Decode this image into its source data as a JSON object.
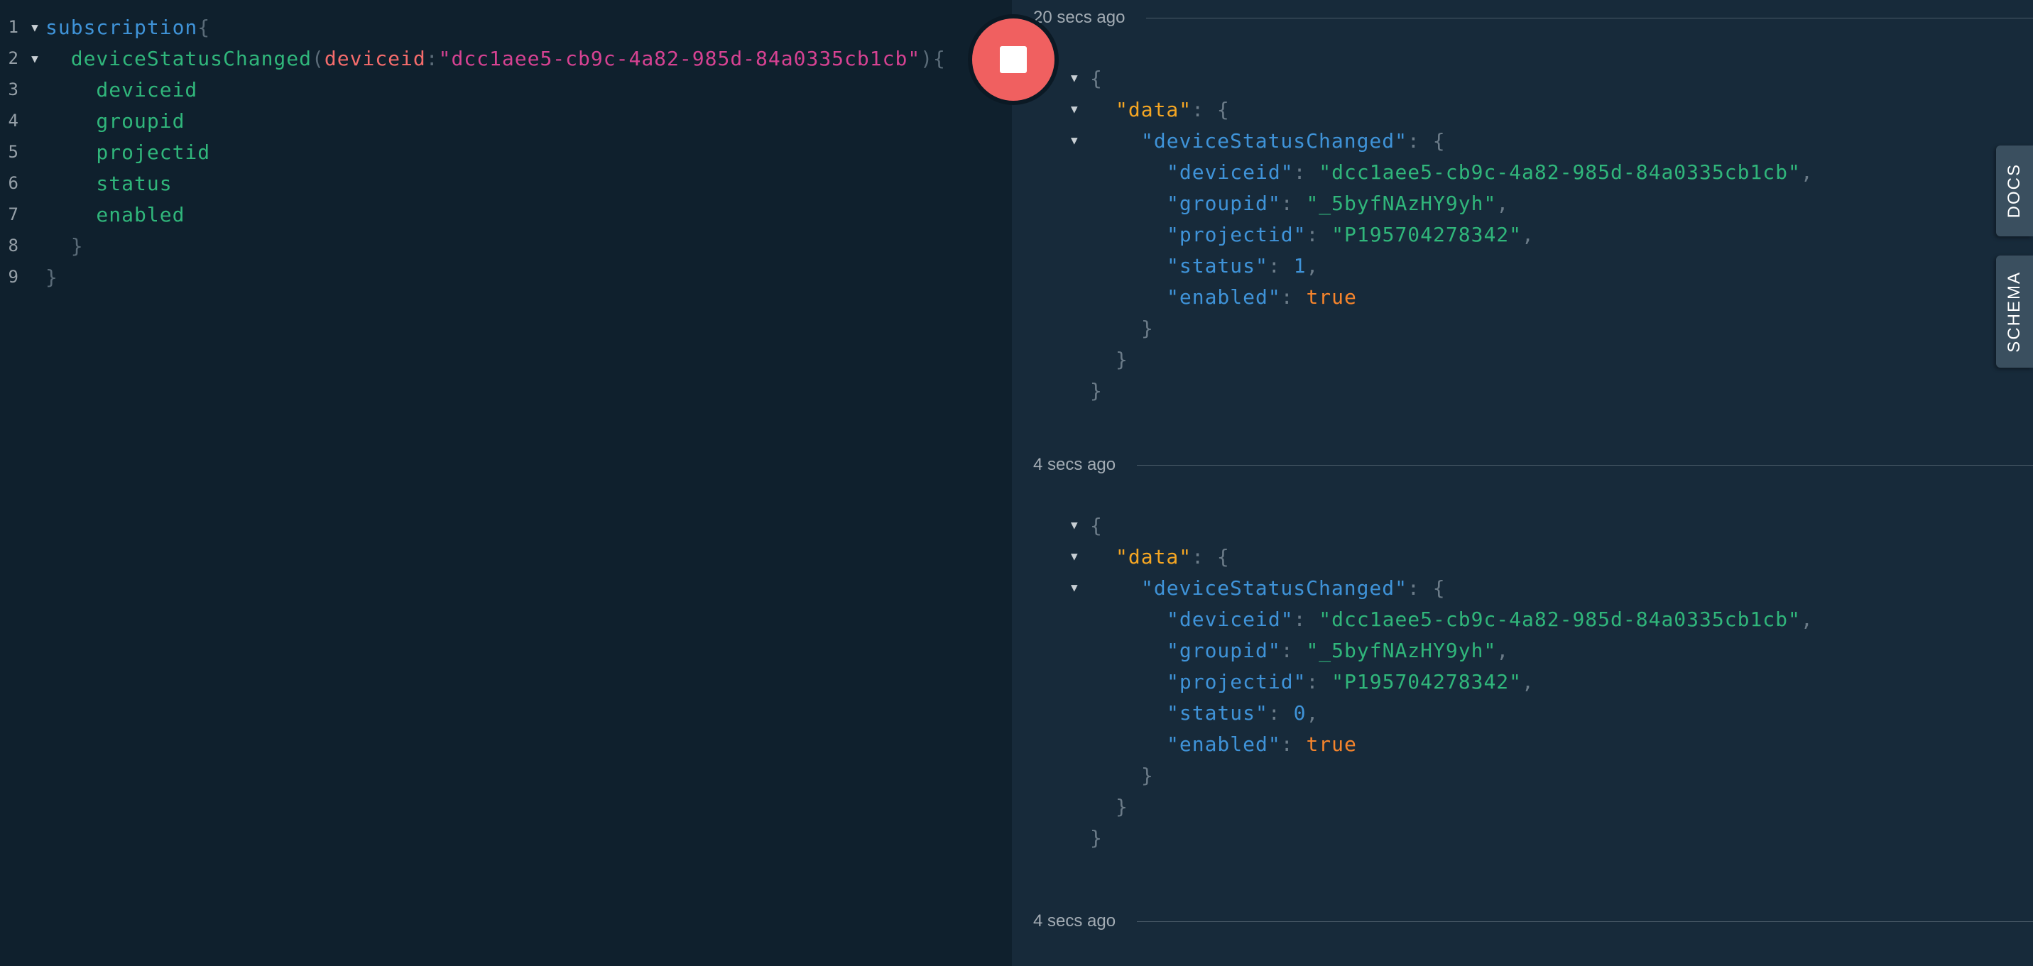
{
  "editor": {
    "lines": [
      {
        "num": "1",
        "parts": [
          {
            "t": "subscription",
            "c": "keyword"
          },
          {
            "t": "{",
            "c": "punct"
          }
        ]
      },
      {
        "num": "2",
        "parts": [
          {
            "t": "  deviceStatusChanged",
            "c": "field"
          },
          {
            "t": "(",
            "c": "punct"
          },
          {
            "t": "deviceid",
            "c": "arg"
          },
          {
            "t": ":",
            "c": "punct"
          },
          {
            "t": "\"dcc1aee5-cb9c-4a82-985d-84a0335cb1cb\"",
            "c": "string"
          },
          {
            "t": "){",
            "c": "punct"
          }
        ]
      },
      {
        "num": "3",
        "parts": [
          {
            "t": "    deviceid",
            "c": "field"
          }
        ]
      },
      {
        "num": "4",
        "parts": [
          {
            "t": "    groupid",
            "c": "field"
          }
        ]
      },
      {
        "num": "5",
        "parts": [
          {
            "t": "    projectid",
            "c": "field"
          }
        ]
      },
      {
        "num": "6",
        "parts": [
          {
            "t": "    status",
            "c": "field"
          }
        ]
      },
      {
        "num": "7",
        "parts": [
          {
            "t": "    enabled",
            "c": "field"
          }
        ]
      },
      {
        "num": "8",
        "parts": [
          {
            "t": "  }",
            "c": "punct"
          }
        ]
      },
      {
        "num": "9",
        "parts": [
          {
            "t": "}",
            "c": "punct"
          }
        ]
      }
    ]
  },
  "results": {
    "timestamps": [
      "20 secs ago",
      "4 secs ago",
      "4 secs ago"
    ],
    "responses": [
      {
        "deviceid": "\"dcc1aee5-cb9c-4a82-985d-84a0335cb1cb\"",
        "groupid": "\"_5byfNAzHY9yh\"",
        "projectid": "\"P195704278342\"",
        "status": "1",
        "enabled": "true"
      },
      {
        "deviceid": "\"dcc1aee5-cb9c-4a82-985d-84a0335cb1cb\"",
        "groupid": "\"_5byfNAzHY9yh\"",
        "projectid": "\"P195704278342\"",
        "status": "0",
        "enabled": "true"
      }
    ],
    "keys": {
      "data": "\"data\"",
      "deviceStatusChanged": "\"deviceStatusChanged\"",
      "deviceid": "\"deviceid\"",
      "groupid": "\"groupid\"",
      "projectid": "\"projectid\"",
      "status": "\"status\"",
      "enabled": "\"enabled\""
    }
  },
  "side_tabs": {
    "docs": "DOCS",
    "schema": "SCHEMA"
  },
  "icons": {
    "stop": "stop-icon",
    "fold": "fold-arrow-icon"
  },
  "colors": {
    "stop_button": "#f06060",
    "keyword": "#3f93d8",
    "field": "#30b67b",
    "argument": "#f56c6c",
    "string": "#d64292",
    "data_key": "#f5a623",
    "boolean": "#f5842c"
  }
}
